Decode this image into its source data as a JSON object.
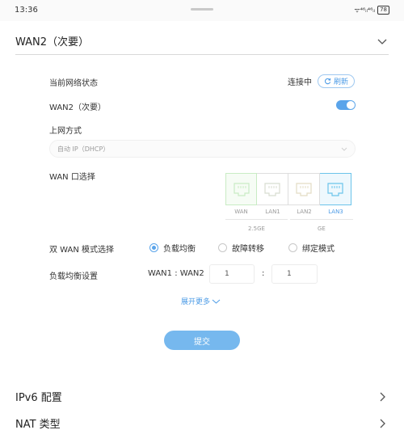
{
  "status_bar": {
    "time": "13:36",
    "signal_text": "ᯤ⁴⁶ᵢₗ⁴⁶ᵢₗ",
    "battery": "78"
  },
  "wan2_section": {
    "title": "WAN2（次要）",
    "expanded": true
  },
  "fields": {
    "network_status_label": "当前网络状态",
    "network_status_value": "连接中",
    "refresh_label": "刷新",
    "wan2_toggle_label": "WAN2（次要）",
    "wan2_toggle_on": true,
    "access_mode_label": "上网方式",
    "access_mode_value": "自动 IP（DHCP）",
    "wan_port_label": "WAN 口选择"
  },
  "ports": [
    {
      "label": "WAN",
      "state": "wan"
    },
    {
      "label": "LAN1",
      "state": "normal"
    },
    {
      "label": "LAN2",
      "state": "normal"
    },
    {
      "label": "LAN3",
      "state": "selected"
    }
  ],
  "port_speeds": [
    "2.5GE",
    "GE"
  ],
  "dual_wan": {
    "label": "双 WAN 模式选择",
    "options": [
      {
        "label": "负载均衡",
        "selected": true
      },
      {
        "label": "故障转移",
        "selected": false
      },
      {
        "label": "绑定模式",
        "selected": false
      }
    ]
  },
  "load_balance": {
    "label": "负载均衡设置",
    "ratio_label": "WAN1 : WAN2",
    "wan1_value": "1",
    "separator": ":",
    "wan2_value": "1"
  },
  "expand_more": "展开更多",
  "submit_label": "提交",
  "collapsed_sections": [
    {
      "title": "IPv6 配置"
    },
    {
      "title": "NAT 类型"
    }
  ],
  "colors": {
    "accent": "#4c9be6",
    "toggle_on": "#5aa4ea",
    "submit_bg": "#76b8ee",
    "wan_port_green": "#c9ecc4",
    "lan3_port_blue": "#6bc4ea"
  }
}
